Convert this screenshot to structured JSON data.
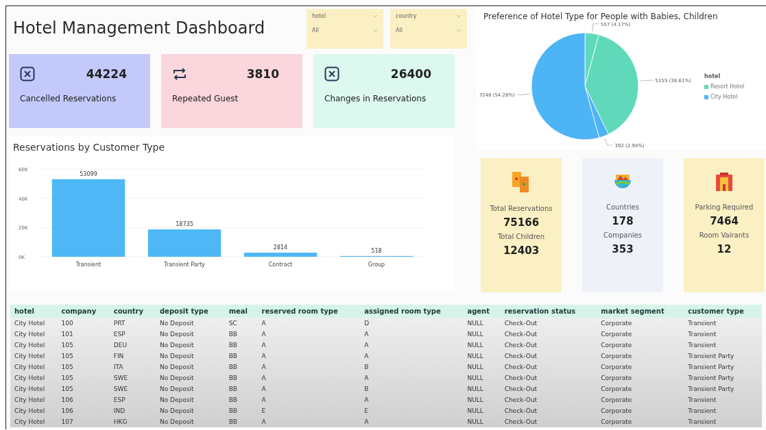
{
  "title": "Hotel Management Dashboard",
  "slicers": [
    {
      "label": "hotel",
      "value": "All"
    },
    {
      "label": "country",
      "value": "All"
    }
  ],
  "kpis": [
    {
      "kind": "cancel",
      "value": "44224",
      "label": "Cancelled Reservations",
      "color": "#c3c9fb"
    },
    {
      "kind": "repeat",
      "value": "3810",
      "label": "Repeated Guest",
      "color": "#fbd6dc"
    },
    {
      "kind": "cancel",
      "value": "26400",
      "label": "Changes in Reservations",
      "color": "#dcf8ef"
    }
  ],
  "bar_panel": {
    "chart_data": {
      "type": "bar",
      "title": "Reservations by Customer Type",
      "categories": [
        "Transient",
        "Transient Party",
        "Contract",
        "Group"
      ],
      "values": [
        53099,
        18735,
        2814,
        518
      ],
      "ylim": [
        0,
        60000
      ],
      "yticks": [
        {
          "value": 0,
          "label": "0K"
        },
        {
          "value": 20000,
          "label": "20K"
        },
        {
          "value": 40000,
          "label": "40K"
        },
        {
          "value": 60000,
          "label": "60K"
        }
      ],
      "data_labels": true
    }
  },
  "pie_panel": {
    "chart_data": {
      "type": "pie",
      "title": "Preference of Hotel Type for People with Babies, Children",
      "values": [
        557,
        5155,
        392,
        7248
      ],
      "colors": [
        "#5fd9b9",
        "#5fd9b9",
        "#4db4f5",
        "#4db4f5"
      ],
      "value_labels": [
        "557 (4.17%)",
        "5155 (38.61%)",
        "392 (2.94%)",
        "7248 (54.28%)"
      ]
    },
    "legend": {
      "title": "hotel",
      "items": [
        {
          "label": "Resort Hotel",
          "color": "#5fd9b9"
        },
        {
          "label": "City Hotel",
          "color": "#4db4f5"
        }
      ]
    }
  },
  "tiles": [
    {
      "kind": "tickets",
      "color": "#fbf0c4",
      "label_1": "Total Reservations",
      "value_1": "75166",
      "label_2": "Total Children",
      "value_2": "12403"
    },
    {
      "kind": "globe",
      "color": "#eef2f8",
      "label_1": "Countries",
      "value_1": "178",
      "label_2": "Companies",
      "value_2": "353"
    },
    {
      "kind": "building",
      "color": "#fbf0c4",
      "label_1": "Parking Required",
      "value_1": "7464",
      "label_2": "Room Vairants",
      "value_2": "12"
    }
  ],
  "table": {
    "columns": [
      "hotel",
      "company",
      "country",
      "deposit type",
      "meal",
      "reserved room type",
      "assigned room type",
      "agent",
      "reservation status",
      "market segment",
      "customer type"
    ],
    "rows": [
      [
        "City Hotel",
        "100",
        "PRT",
        "No Deposit",
        "SC",
        "A",
        "D",
        "NULL",
        "Check-Out",
        "Corporate",
        "Transient"
      ],
      [
        "City Hotel",
        "101",
        "ESP",
        "No Deposit",
        "BB",
        "A",
        "A",
        "NULL",
        "Check-Out",
        "Corporate",
        "Transient"
      ],
      [
        "City Hotel",
        "105",
        "DEU",
        "No Deposit",
        "BB",
        "A",
        "A",
        "NULL",
        "Check-Out",
        "Corporate",
        "Transient"
      ],
      [
        "City Hotel",
        "105",
        "FIN",
        "No Deposit",
        "BB",
        "A",
        "A",
        "NULL",
        "Check-Out",
        "Corporate",
        "Transient Party"
      ],
      [
        "City Hotel",
        "105",
        "ITA",
        "No Deposit",
        "BB",
        "A",
        "B",
        "NULL",
        "Check-Out",
        "Corporate",
        "Transient Party"
      ],
      [
        "City Hotel",
        "105",
        "SWE",
        "No Deposit",
        "BB",
        "A",
        "A",
        "NULL",
        "Check-Out",
        "Corporate",
        "Transient Party"
      ],
      [
        "City Hotel",
        "105",
        "SWE",
        "No Deposit",
        "BB",
        "A",
        "B",
        "NULL",
        "Check-Out",
        "Corporate",
        "Transient Party"
      ],
      [
        "City Hotel",
        "106",
        "ESP",
        "No Deposit",
        "BB",
        "A",
        "A",
        "NULL",
        "Check-Out",
        "Corporate",
        "Transient"
      ],
      [
        "City Hotel",
        "106",
        "IND",
        "No Deposit",
        "BB",
        "E",
        "E",
        "NULL",
        "Check-Out",
        "Corporate",
        "Transient"
      ],
      [
        "City Hotel",
        "107",
        "HKG",
        "No Deposit",
        "BB",
        "A",
        "A",
        "NULL",
        "Check-Out",
        "Corporate",
        "Transient"
      ]
    ]
  }
}
